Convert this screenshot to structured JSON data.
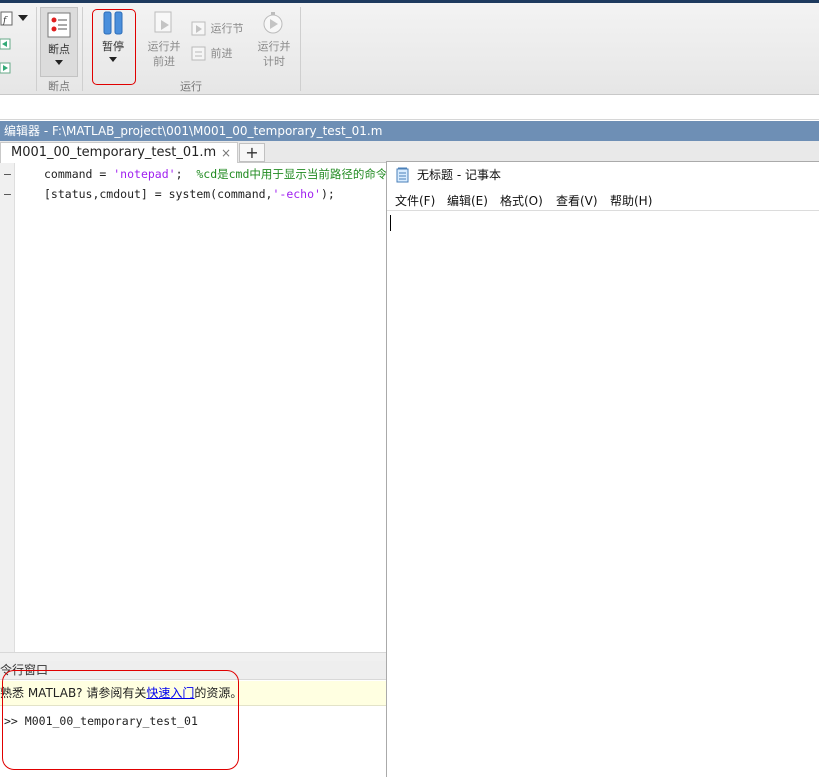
{
  "toolstrip": {
    "breakpoint_button_label": "断点",
    "breakpoint_section_label": "断点",
    "pause_button_label": "暂停",
    "run_advance_label_line1": "运行并",
    "run_advance_label_line2": "前进",
    "run_section_label": "运行节",
    "advance_label": "前进",
    "run_time_label_line1": "运行并",
    "run_time_label_line2": "计时",
    "run_group_label": "运行"
  },
  "editor": {
    "title": "编辑器 - F:\\MATLAB_project\\001\\M001_00_temporary_test_01.m",
    "tab_label": "M001_00_temporary_test_01.m",
    "tab_close": "×",
    "tab_add": "+",
    "lines": [
      {
        "marker": "–",
        "p1": "command = ",
        "p2": "'notepad'",
        "p3": ";  ",
        "p4": "%cd是cmd中用于显示当前路径的命令"
      },
      {
        "marker": "–",
        "p1": "[status,cmdout] = system(command,",
        "p2": "'-echo'",
        "p3": ");",
        "p4": ""
      }
    ]
  },
  "command_window": {
    "title": "令行窗口",
    "info_prefix": "熟悉 MATLAB? 请参阅有关",
    "info_link": "快速入门",
    "info_suffix": "的资源。",
    "prompt": ">>",
    "command": "M001_00_temporary_test_01"
  },
  "notepad": {
    "title": "无标题 - 记事本",
    "menu": [
      "文件(F)",
      "编辑(E)",
      "格式(O)",
      "查看(V)",
      "帮助(H)"
    ]
  },
  "colors": {
    "highlight": "#e00000",
    "editor_title_bar": "#6e8fb5",
    "string": "#a020f0",
    "comment": "#228b22"
  }
}
